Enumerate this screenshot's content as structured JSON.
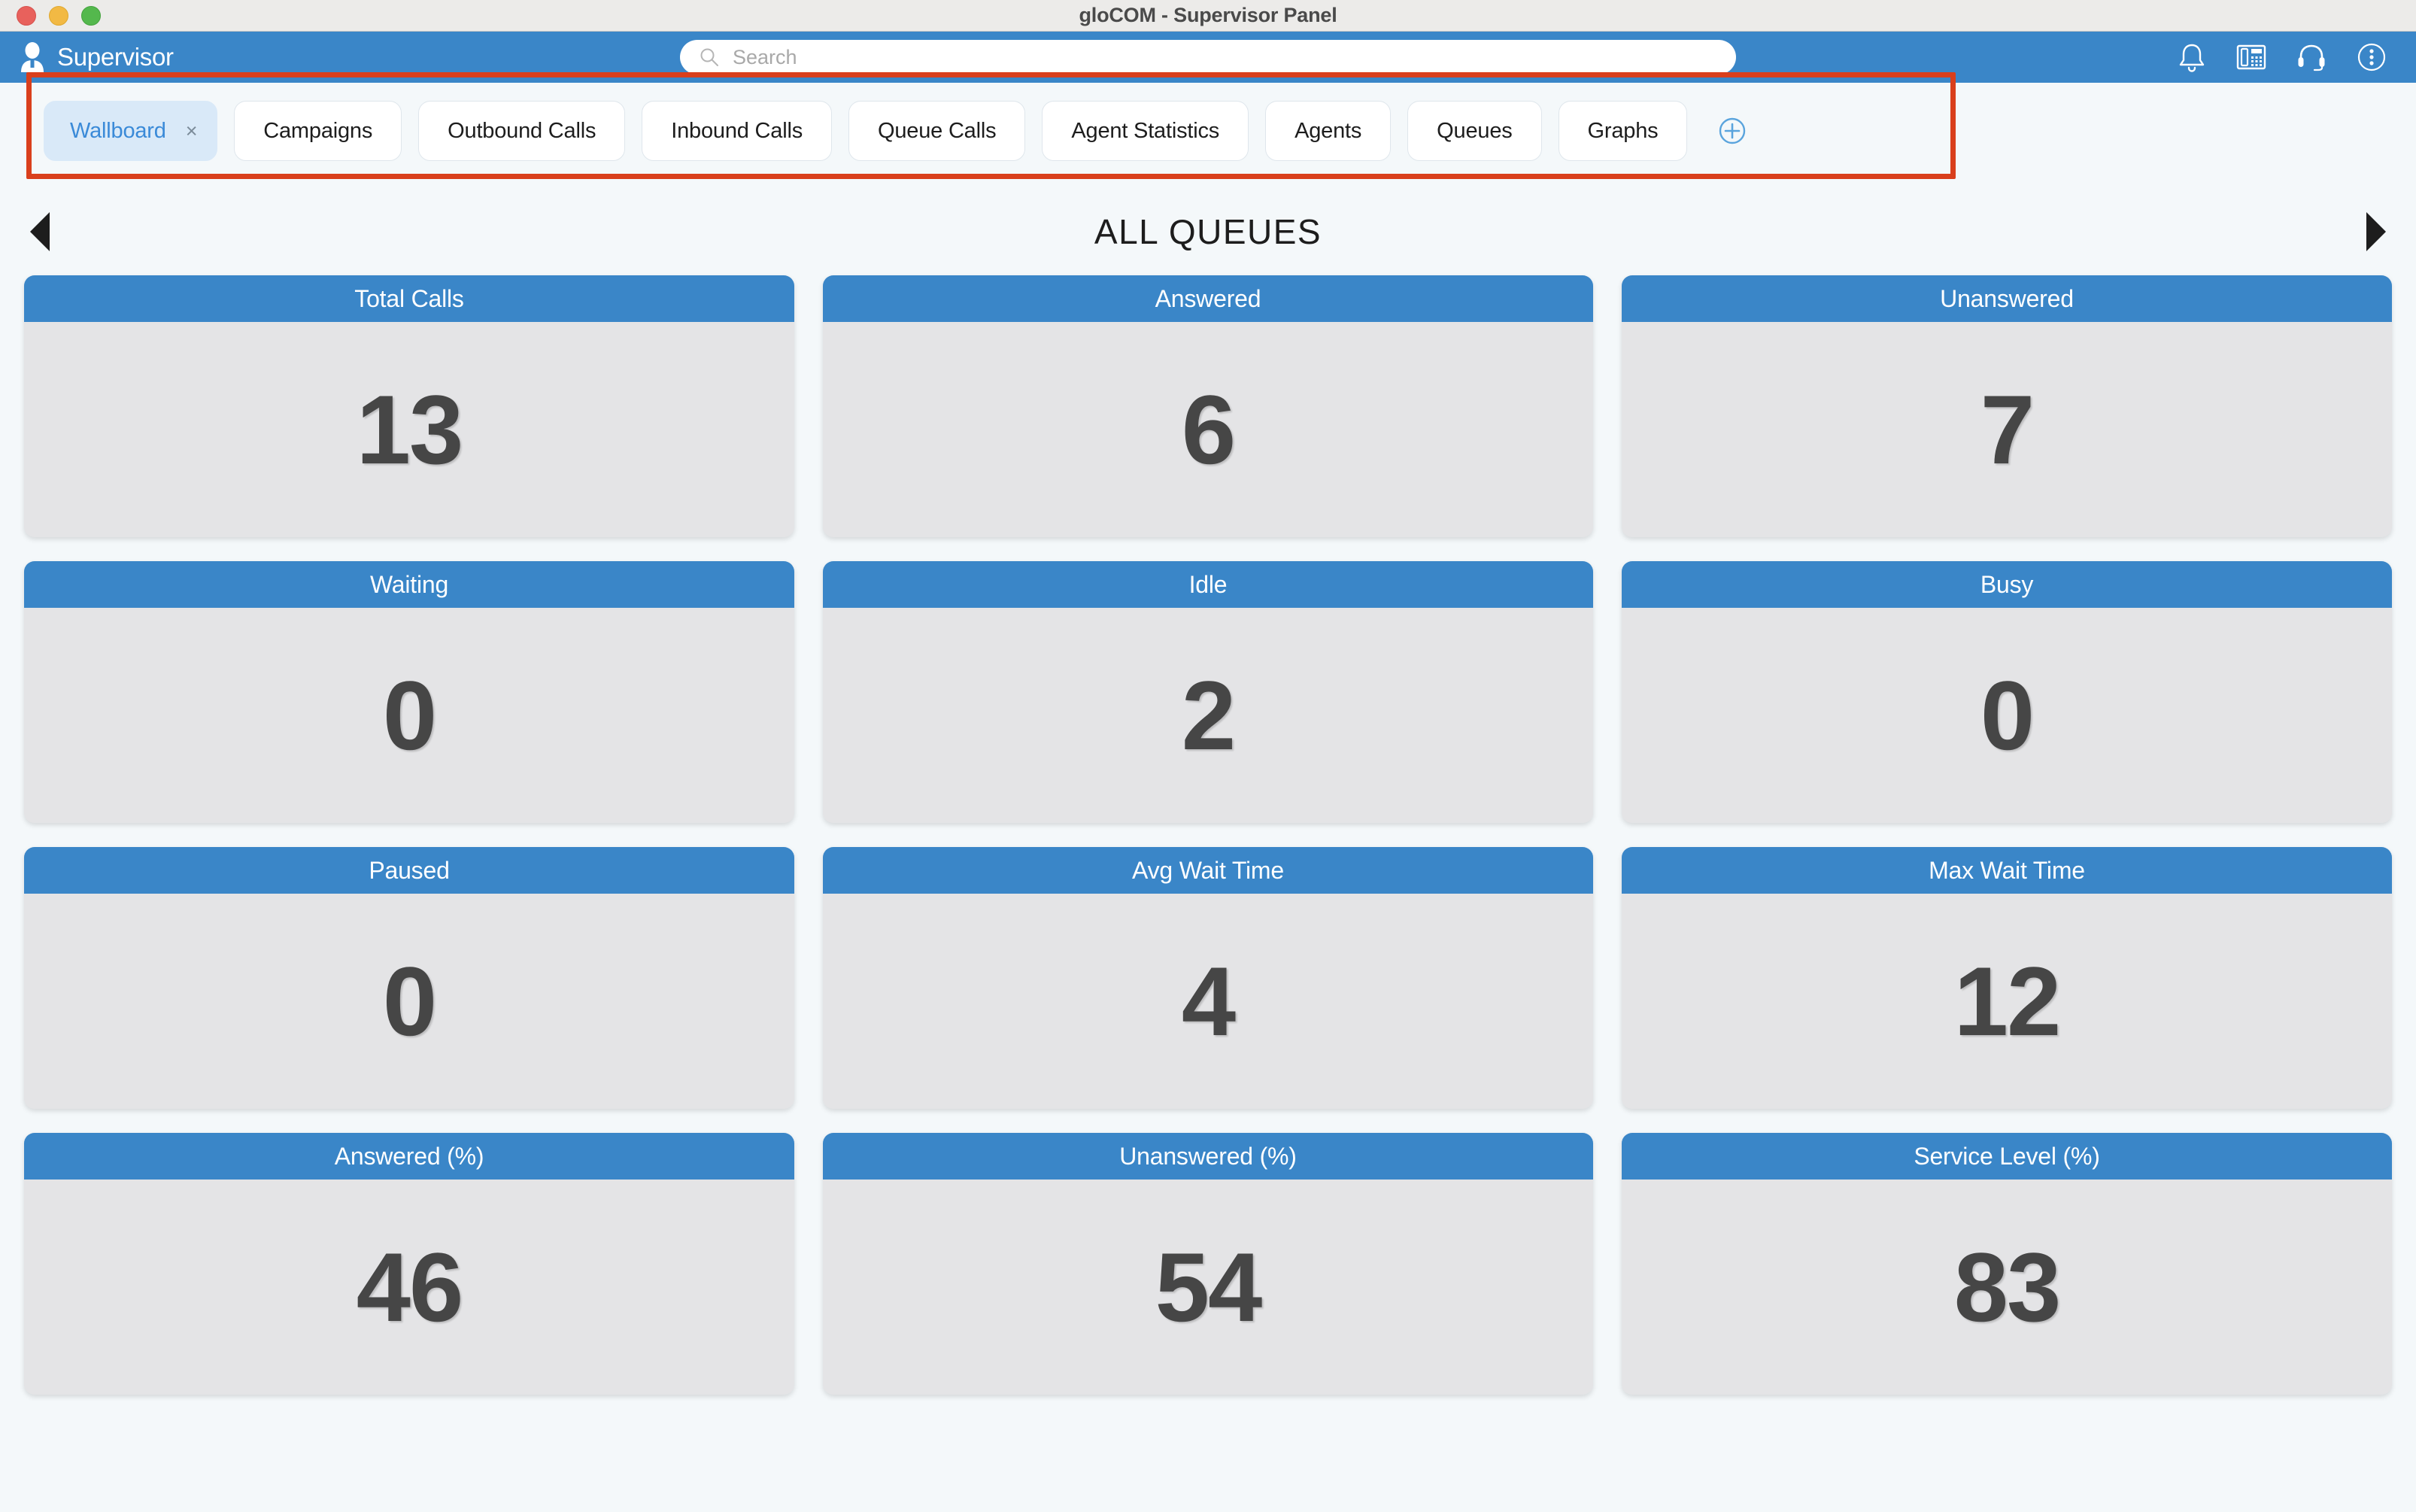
{
  "window": {
    "title": "gloCOM - Supervisor Panel",
    "controls": [
      "close",
      "minimize",
      "maximize"
    ]
  },
  "appbar": {
    "user_icon": "user-icon",
    "user_name": "Supervisor",
    "search": {
      "icon": "search-icon",
      "value": "",
      "placeholder": "Search"
    },
    "icons": [
      {
        "name": "bell-icon"
      },
      {
        "name": "desk-phone-icon"
      },
      {
        "name": "headset-icon"
      },
      {
        "name": "more-options-icon"
      }
    ]
  },
  "tabs": {
    "items": [
      {
        "label": "Wallboard",
        "active": true,
        "close_glyph": "×"
      },
      {
        "label": "Campaigns",
        "active": false
      },
      {
        "label": "Outbound Calls",
        "active": false
      },
      {
        "label": "Inbound Calls",
        "active": false
      },
      {
        "label": "Queue Calls",
        "active": false
      },
      {
        "label": "Agent Statistics",
        "active": false
      },
      {
        "label": "Agents",
        "active": false
      },
      {
        "label": "Queues",
        "active": false
      },
      {
        "label": "Graphs",
        "active": false
      }
    ],
    "add_tab_icon": "add-tab-icon",
    "highlight_color": "#d93f1c"
  },
  "queue_nav": {
    "prev_icon": "prev-queue-arrow-icon",
    "title": "ALL QUEUES",
    "next_icon": "next-queue-arrow-icon"
  },
  "wallboard": {
    "accent_color": "#3a86c8",
    "card_body_color": "#e4e4e6",
    "value_color": "#464646",
    "cards": [
      {
        "label": "Total Calls",
        "value": "13"
      },
      {
        "label": "Answered",
        "value": "6"
      },
      {
        "label": "Unanswered",
        "value": "7"
      },
      {
        "label": "Waiting",
        "value": "0"
      },
      {
        "label": "Idle",
        "value": "2"
      },
      {
        "label": "Busy",
        "value": "0"
      },
      {
        "label": "Paused",
        "value": "0"
      },
      {
        "label": "Avg Wait Time",
        "value": "4"
      },
      {
        "label": "Max Wait Time",
        "value": "12"
      },
      {
        "label": "Answered (%)",
        "value": "46"
      },
      {
        "label": "Unanswered (%)",
        "value": "54"
      },
      {
        "label": "Service Level (%)",
        "value": "83"
      }
    ]
  }
}
